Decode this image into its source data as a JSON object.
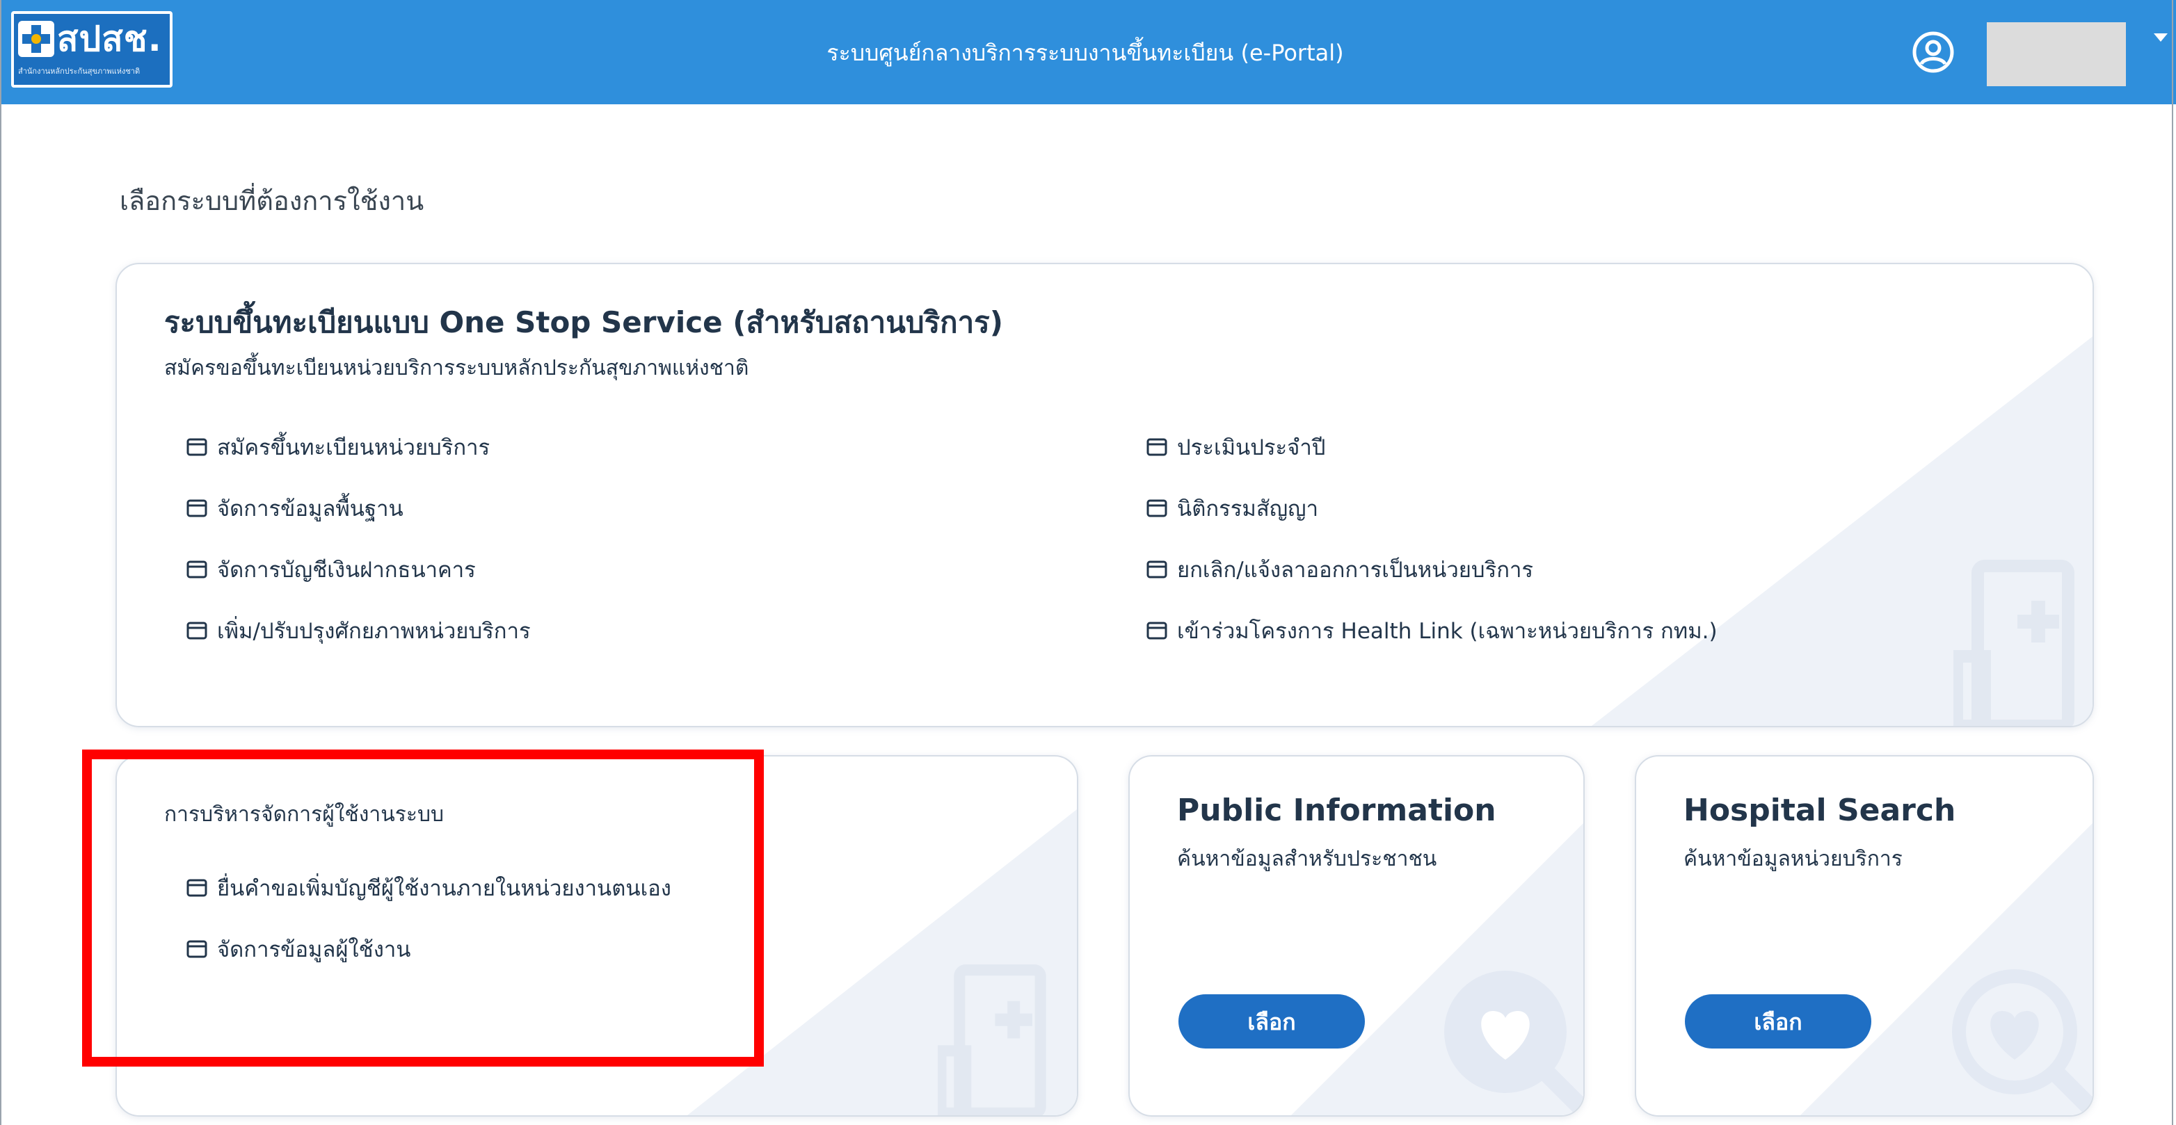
{
  "header": {
    "logo_text": "สปสช.",
    "logo_subtitle": "สำนักงานหลักประกันสุขภาพแห่งชาติ",
    "title": "ระบบศูนย์กลางบริการระบบงานขึ้นทะเบียน (e-Portal)",
    "user_name": ""
  },
  "page": {
    "title": "เลือกระบบที่ต้องการใช้งาน"
  },
  "one_stop": {
    "title": "ระบบขึ้นทะเบียนแบบ One Stop Service (สำหรับสถานบริการ)",
    "description": "สมัครขอขึ้นทะเบียนหน่วยบริการระบบหลักประกันสุขภาพแห่งชาติ",
    "left_items": [
      {
        "label": "สมัครขึ้นทะเบียนหน่วยบริการ"
      },
      {
        "label": "จัดการข้อมูลพื้นฐาน"
      },
      {
        "label": "จัดการบัญชีเงินฝากธนาคาร"
      },
      {
        "label": "เพิ่ม/ปรับปรุงศักยภาพหน่วยบริการ"
      }
    ],
    "right_items": [
      {
        "label": "ประเมินประจำปี"
      },
      {
        "label": "นิติกรรมสัญญา"
      },
      {
        "label": "ยกเลิก/แจ้งลาออกการเป็นหน่วยบริการ"
      },
      {
        "label": "เข้าร่วมโครงการ Health Link (เฉพาะหน่วยบริการ กทม.)"
      }
    ]
  },
  "user_mgmt": {
    "title": "การบริหารจัดการผู้ใช้งานระบบ",
    "items": [
      {
        "label": "ยื่นคำขอเพิ่มบัญชีผู้ใช้งานภายในหน่วยงานตนเอง"
      },
      {
        "label": "จัดการข้อมูลผู้ใช้งาน"
      }
    ]
  },
  "public_info": {
    "title": "Public Information",
    "description": "ค้นหาข้อมูลสำหรับประชาชน",
    "button": "เลือก"
  },
  "hospital_search": {
    "title": "Hospital Search",
    "description": "ค้นหาข้อมูลหน่วยบริการ",
    "button": "เลือก"
  },
  "colors": {
    "header_bg": "#2f8fdc",
    "button_bg": "#1f6fc4",
    "highlight": "#ff0000",
    "text": "#22354a"
  },
  "icons": {
    "menu_item": "browser-window-icon",
    "user": "user-circle-icon",
    "decor_building": "hospital-building-icon",
    "decor_search": "magnifier-heart-icon"
  }
}
